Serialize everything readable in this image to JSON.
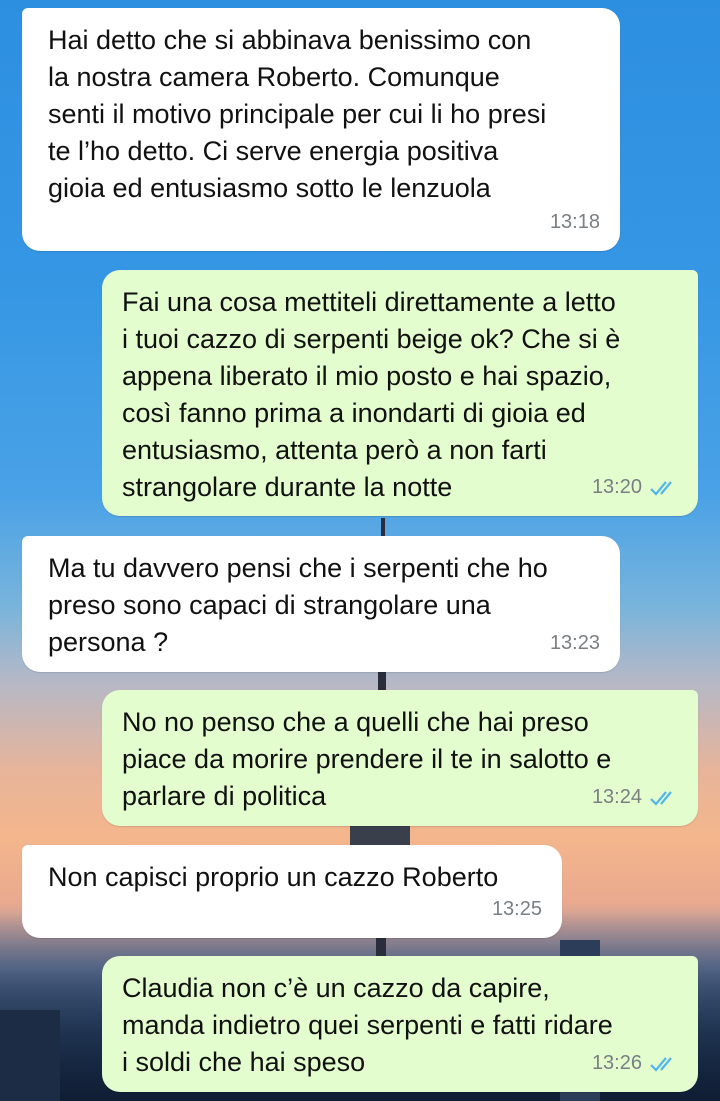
{
  "messages": [
    {
      "direction": "in",
      "text": "Hai detto che si abbinava benissimo con\nla nostra camera Roberto. Comunque\nsenti il motivo principale per cui li ho presi\nte l’ho detto. Ci serve energia positiva\ngioia ed entusiasmo sotto le lenzuola",
      "time": "13:18"
    },
    {
      "direction": "out",
      "text": "Fai una cosa mettiteli direttamente a letto\ni tuoi cazzo di serpenti beige ok? Che si è\nappena liberato il mio posto e hai spazio,\ncosì fanno prima a inondarti di gioia ed\nentusiasmo, attenta però a non farti\nstrangolare durante la notte",
      "time": "13:20",
      "status": "read"
    },
    {
      "direction": "in",
      "text": "Ma tu davvero pensi che i serpenti che ho\npreso sono capaci di strangolare una\npersona ?",
      "time": "13:23"
    },
    {
      "direction": "out",
      "text": "No no penso che a quelli che hai preso\npiace da morire prendere il te in salotto e\nparlare di politica",
      "time": "13:24",
      "status": "read"
    },
    {
      "direction": "in",
      "text": "Non capisci proprio un cazzo Roberto",
      "time": "13:25"
    },
    {
      "direction": "out",
      "text": "Claudia non c’è un cazzo da capire,\nmanda indietro quei serpenti e fatti ridare\ni soldi che hai speso",
      "time": "13:26",
      "status": "read"
    }
  ],
  "colors": {
    "incoming_bubble": "#ffffff",
    "outgoing_bubble": "#e4fdcf",
    "read_ticks": "#4fb6ec",
    "timestamp": "#7a7f83"
  },
  "icons": {
    "read_status": "double-check-icon"
  }
}
